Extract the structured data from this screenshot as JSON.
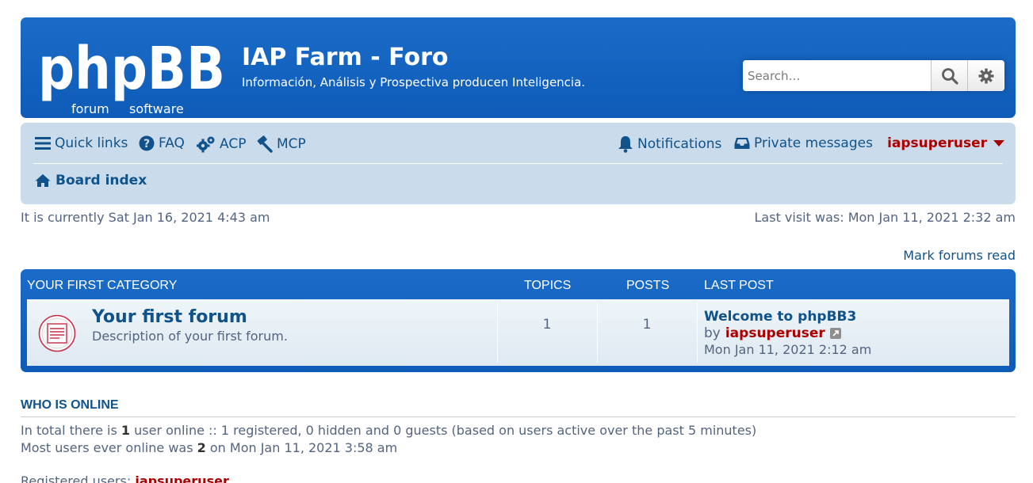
{
  "header": {
    "logo_main": "phpBB",
    "logo_sub_left": "forum",
    "logo_sub_right": "software",
    "site_title": "IAP Farm - Foro",
    "site_description": "Información, Análisis y Prospectiva producen Inteligencia.",
    "search_placeholder": "Search…"
  },
  "navbar": {
    "quick_links": "Quick links",
    "faq": "FAQ",
    "acp": "ACP",
    "mcp": "MCP",
    "notifications": "Notifications",
    "private_messages": "Private messages",
    "username": "iapsuperuser",
    "board_index": "Board index"
  },
  "status": {
    "current_time": "It is currently Sat Jan 16, 2021 4:43 am",
    "last_visit": "Last visit was: Mon Jan 11, 2021 2:32 am",
    "mark_read": "Mark forums read"
  },
  "category": {
    "name": "Your first category",
    "col_topics": "Topics",
    "col_posts": "Posts",
    "col_last_post": "Last post",
    "forums": [
      {
        "title": "Your first forum",
        "description": "Description of your first forum.",
        "topics": "1",
        "posts": "1",
        "last_post_title": "Welcome to phpBB3",
        "last_post_by": "by",
        "last_post_user": "iapsuperuser",
        "last_post_date": "Mon Jan 11, 2021 2:12 am"
      }
    ]
  },
  "who_online": {
    "title": "WHO IS ONLINE",
    "line1_a": "In total there is ",
    "line1_count": "1",
    "line1_b": " user online :: 1 registered, 0 hidden and 0 guests (based on users active over the past 5 minutes)",
    "line2_a": "Most users ever online was ",
    "line2_count": "2",
    "line2_b": " on Mon Jan 11, 2021 3:58 am",
    "registered_label": "Registered users: ",
    "registered_user": "iapsuperuser"
  },
  "colors": {
    "header_blue": "#1a6cc8",
    "navbar_bg": "#cadceb",
    "link_blue": "#105289",
    "admin_red": "#aa0000",
    "text_gray": "#536482"
  }
}
